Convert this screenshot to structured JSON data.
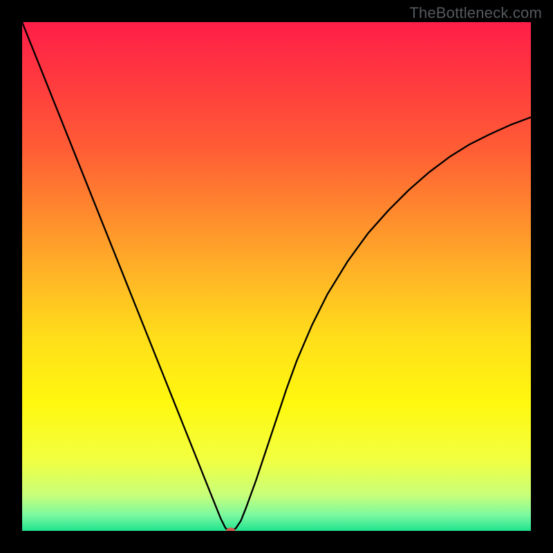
{
  "watermark": "TheBottleneck.com",
  "chart_data": {
    "type": "line",
    "title": "",
    "xlabel": "",
    "ylabel": "",
    "xlim": [
      0,
      100
    ],
    "ylim": [
      0,
      100
    ],
    "grid": false,
    "legend": false,
    "background_gradient": {
      "stops": [
        {
          "offset": 0.0,
          "color": "#ff1e48"
        },
        {
          "offset": 0.12,
          "color": "#ff3b3e"
        },
        {
          "offset": 0.25,
          "color": "#ff5d35"
        },
        {
          "offset": 0.38,
          "color": "#ff8b2d"
        },
        {
          "offset": 0.5,
          "color": "#ffb626"
        },
        {
          "offset": 0.62,
          "color": "#ffde1a"
        },
        {
          "offset": 0.75,
          "color": "#fff80f"
        },
        {
          "offset": 0.86,
          "color": "#f2ff40"
        },
        {
          "offset": 0.93,
          "color": "#c7ff7a"
        },
        {
          "offset": 0.97,
          "color": "#79f9a0"
        },
        {
          "offset": 1.0,
          "color": "#1fe38f"
        }
      ]
    },
    "series": [
      {
        "name": "bottleneck-curve",
        "color": "#000000",
        "width": 2.4,
        "x": [
          0.0,
          2.0,
          4.0,
          6.0,
          8.0,
          10.0,
          12.0,
          14.0,
          16.0,
          18.0,
          20.0,
          22.0,
          24.0,
          26.0,
          28.0,
          30.0,
          32.0,
          34.0,
          36.0,
          38.0,
          39.0,
          40.0,
          41.0,
          42.0,
          43.0,
          44.0,
          46.0,
          48.0,
          50.0,
          52.0,
          54.0,
          57.0,
          60.0,
          64.0,
          68.0,
          72.0,
          76.0,
          80.0,
          84.0,
          88.0,
          92.0,
          96.0,
          100.0
        ],
        "y": [
          100.0,
          95.0,
          90.0,
          85.0,
          80.0,
          75.0,
          70.0,
          65.0,
          60.0,
          55.0,
          50.0,
          45.0,
          40.0,
          35.0,
          30.0,
          25.0,
          20.0,
          15.0,
          10.0,
          5.0,
          2.5,
          0.5,
          0.0,
          0.5,
          2.0,
          4.5,
          10.0,
          16.0,
          22.0,
          28.0,
          33.5,
          40.5,
          46.5,
          53.0,
          58.5,
          63.0,
          67.0,
          70.5,
          73.5,
          76.0,
          78.0,
          79.8,
          81.3
        ]
      }
    ],
    "marker": {
      "name": "optimal-point",
      "x": 41.0,
      "y": 0.0,
      "rx": 0.9,
      "ry": 0.65,
      "color": "#d65a4b"
    }
  }
}
